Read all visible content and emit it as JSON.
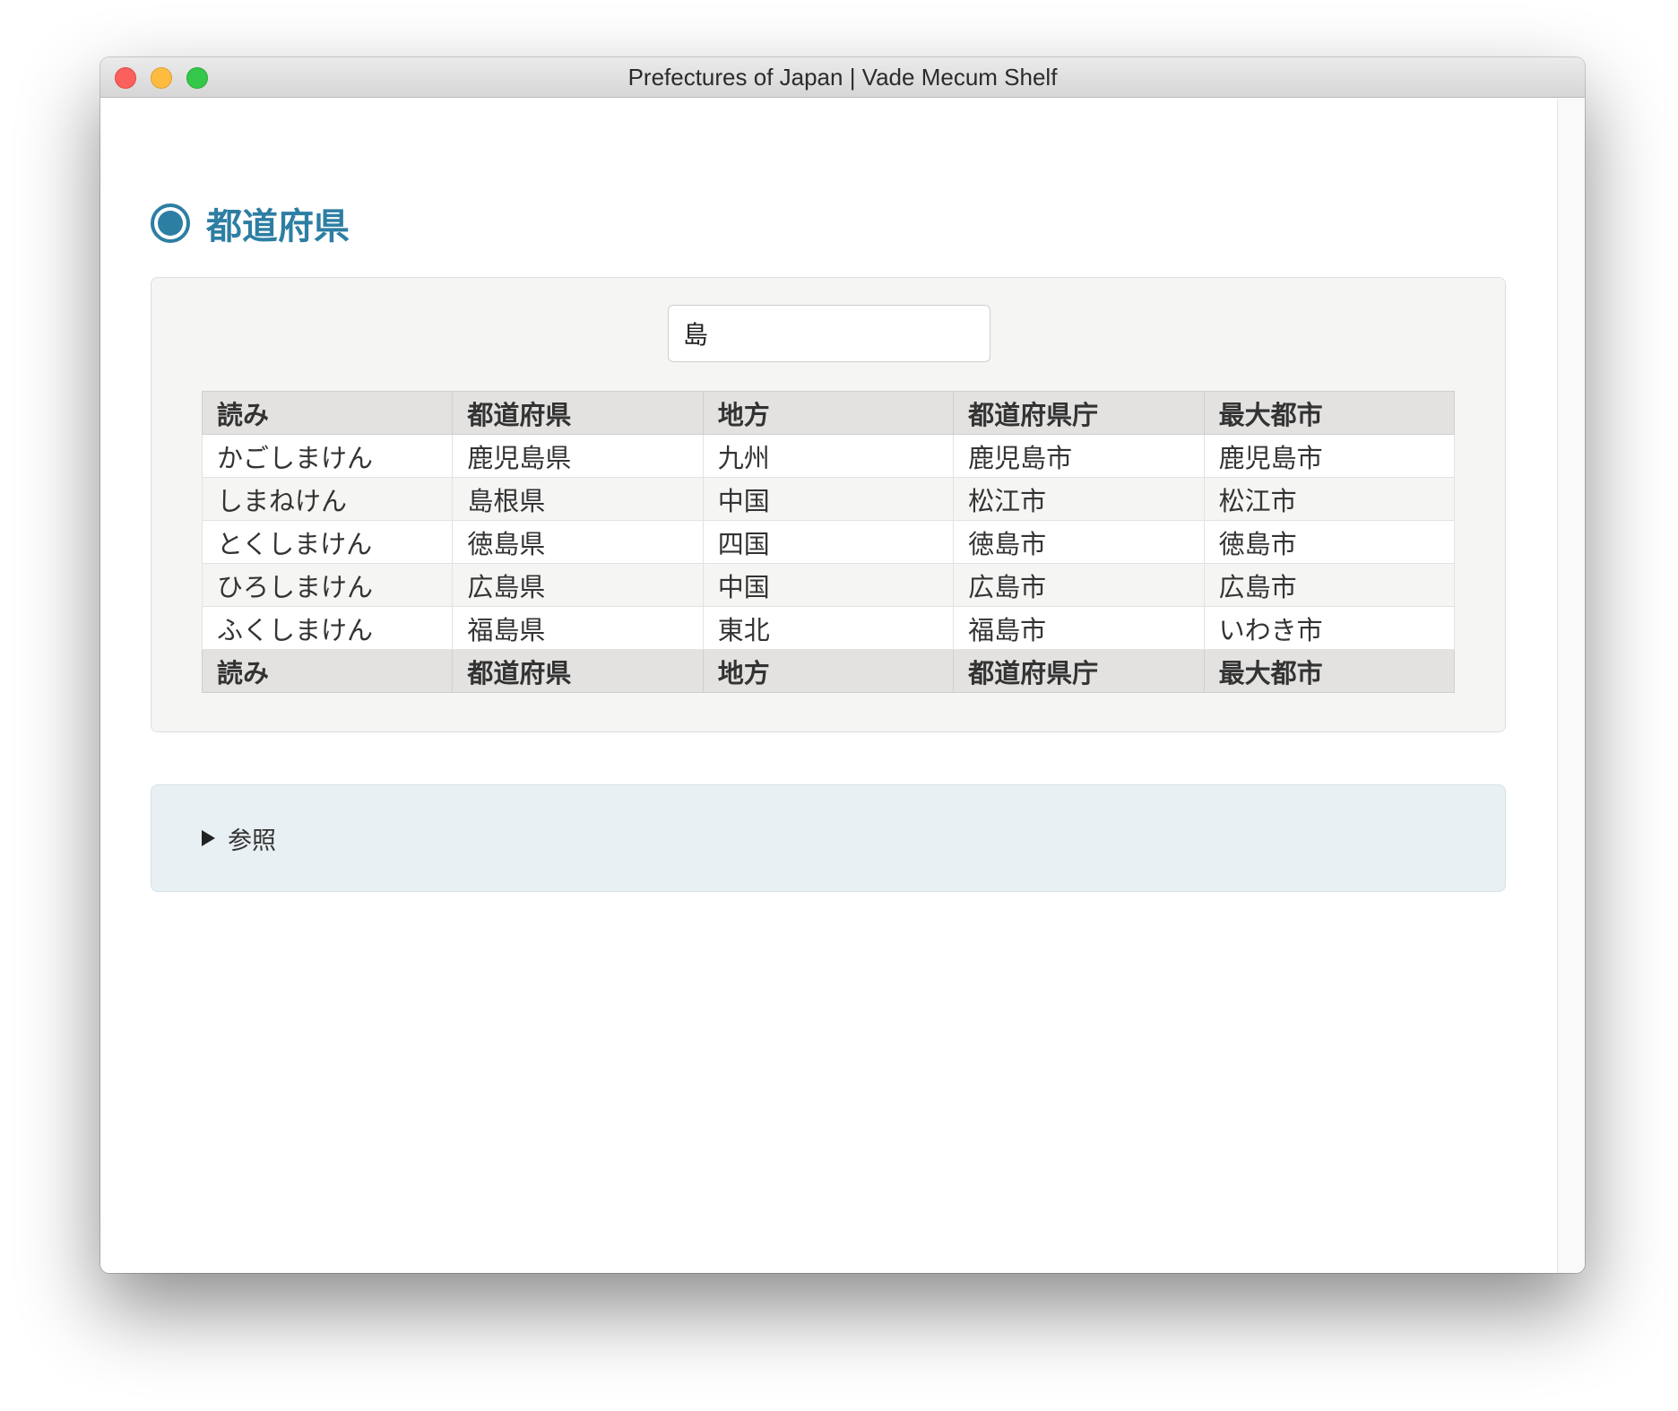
{
  "window": {
    "title": "Prefectures of Japan | Vade Mecum Shelf"
  },
  "page": {
    "heading": "都道府県"
  },
  "search": {
    "value": "島"
  },
  "table": {
    "columns": [
      "読み",
      "都道府県",
      "地方",
      "都道府県庁",
      "最大都市"
    ],
    "rows": [
      [
        "かごしまけん",
        "鹿児島県",
        "九州",
        "鹿児島市",
        "鹿児島市"
      ],
      [
        "しまねけん",
        "島根県",
        "中国",
        "松江市",
        "松江市"
      ],
      [
        "とくしまけん",
        "徳島県",
        "四国",
        "徳島市",
        "徳島市"
      ],
      [
        "ひろしまけん",
        "広島県",
        "中国",
        "広島市",
        "広島市"
      ],
      [
        "ふくしまけん",
        "福島県",
        "東北",
        "福島市",
        "いわき市"
      ]
    ]
  },
  "references": {
    "label": "参照"
  },
  "colors": {
    "accent": "#2d7ea3",
    "panel": "#f5f5f4",
    "refs_panel": "#e9f0f3",
    "header_cell": "#e3e2e0"
  }
}
